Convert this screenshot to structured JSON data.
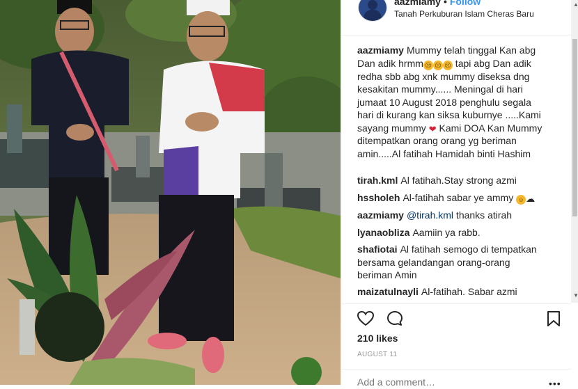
{
  "post": {
    "username": "aazmiamy",
    "separator": "•",
    "follow_label": "Follow",
    "location": "Tanah Perkuburan Islam Cheras Baru"
  },
  "caption": {
    "username": "aazmiamy",
    "text_part1": "Mummy telah tinggal Kan abg Dan adik hrmm",
    "text_part2": " tapi abg Dan adik redha sbb abg xnk mummy diseksa dng kesakitan mummy...... Meningal di hari jumaat 10 August 2018 penghulu segala hari di kurang kan siksa kuburnye .....Kami sayang mummy ",
    "text_part3": " Kami DOA Kan Mummy ditempatkan orang orang yg beriman amin.....Al fatihah Hamidah binti Hashim"
  },
  "comments": [
    {
      "username": "tirah.kml",
      "text": "Al fatihah.Stay strong azmi"
    },
    {
      "username": "hssholeh",
      "text": "Al-fatihah sabar ye ammy"
    },
    {
      "username": "aazmiamy",
      "mention": "@tirah.kml",
      "text": " thanks atirah"
    },
    {
      "username": "lyanaobliza",
      "text": "Aamiin ya rabb."
    },
    {
      "username": "shafiotai",
      "text": "Al fatihah semogo di tempatkan bersama gelandangan orang-orang beriman Amin"
    },
    {
      "username": "maizatulnayli",
      "text": "Al-fatihah. Sabar azmi"
    }
  ],
  "icons": {
    "like": "heart-outline-icon",
    "comment": "comment-bubble-icon",
    "save": "bookmark-icon",
    "more": "ellipsis-icon"
  },
  "likes_text": "210 likes",
  "date_text": "AUGUST 11",
  "add_comment_placeholder": "Add a comment…",
  "more_glyph": "•••",
  "colors": {
    "link_blue": "#3897f0",
    "text": "#262626",
    "muted": "#999999",
    "border": "#efefef"
  }
}
